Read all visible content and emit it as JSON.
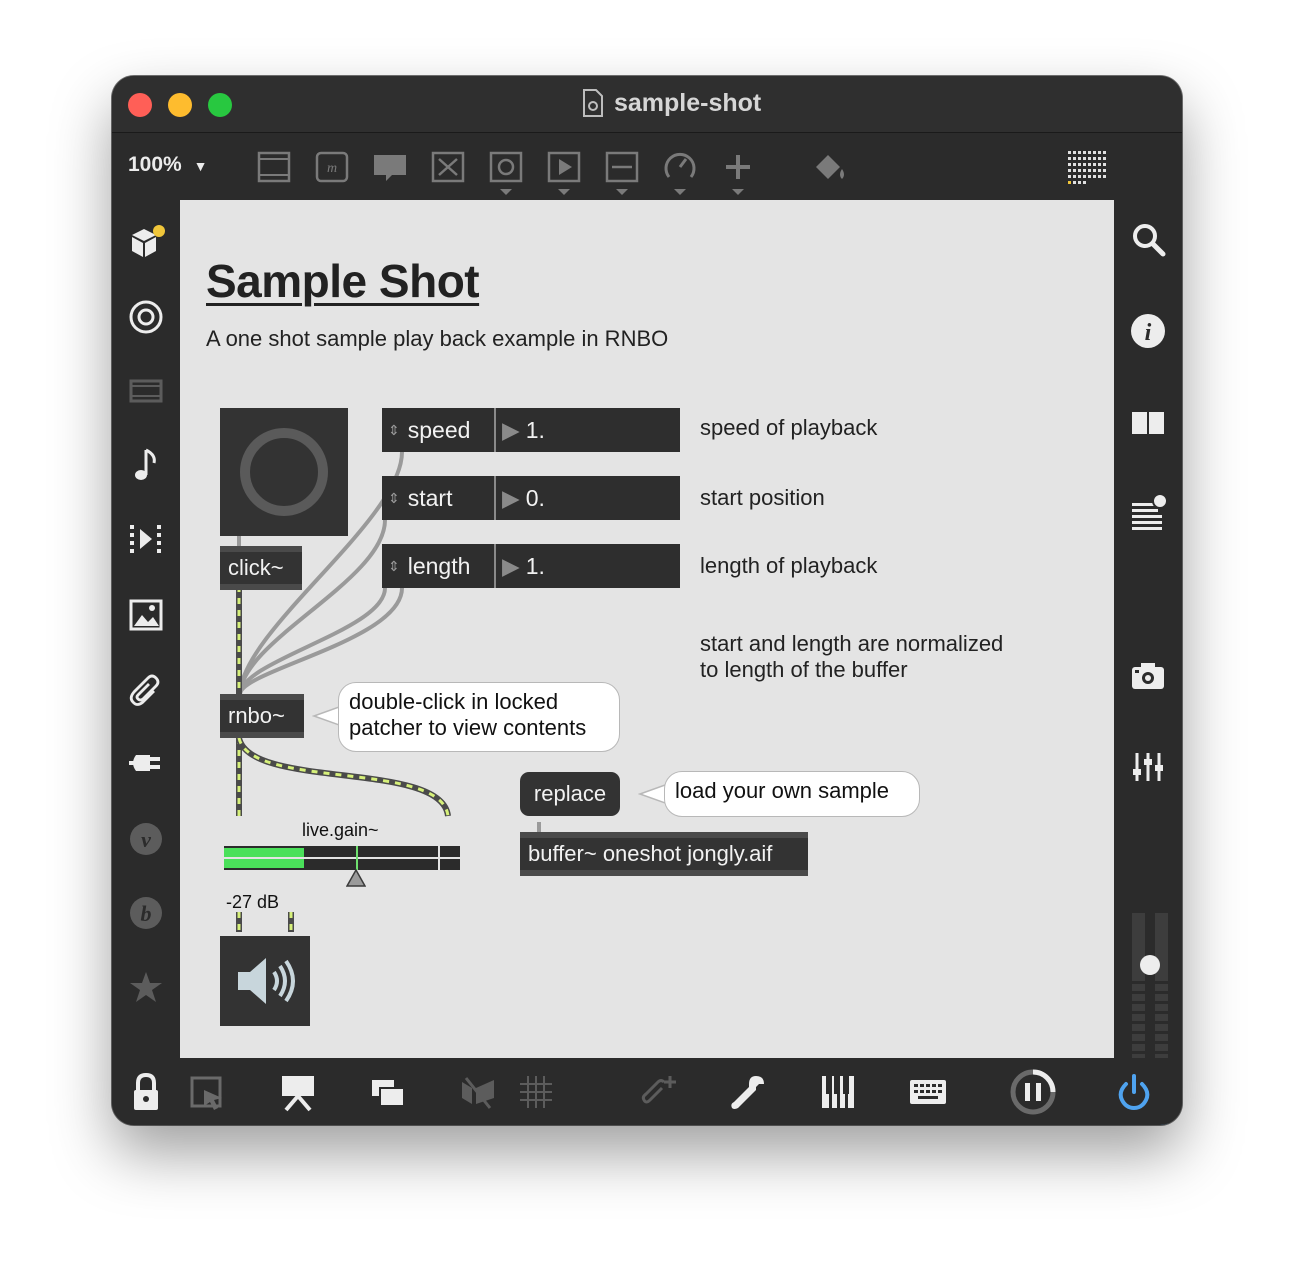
{
  "window": {
    "title": "sample-shot",
    "zoom": "100%",
    "colors": {
      "close": "#ff5f57",
      "minimize": "#febc2e",
      "maximize": "#28c840",
      "canvas": "#e4e4e4",
      "object": "#333333",
      "accent_blue": "#4fa3ef"
    }
  },
  "toolbar": {
    "icons": [
      "new-object-icon",
      "message-icon",
      "comment-icon",
      "button-icon",
      "toggle-icon",
      "play-icon",
      "slider-icon",
      "dial-icon",
      "add-icon",
      "paint-bucket-icon",
      "grid-icon"
    ]
  },
  "left_sidebar": {
    "icons": [
      "packages-icon",
      "target-icon",
      "film-icon",
      "music-note-icon",
      "step-icon",
      "image-icon",
      "paperclip-icon",
      "plug-icon",
      "v-icon",
      "b-icon",
      "star-icon"
    ]
  },
  "right_sidebar": {
    "icons": [
      "search-icon",
      "info-icon",
      "book-icon",
      "list-icon",
      "camera-icon",
      "mixer-icon"
    ],
    "meter_level": 0.6
  },
  "bottom_toolbar": {
    "icons": [
      "lock-icon",
      "select-icon",
      "presentation-icon",
      "windows-icon",
      "no-icon",
      "grid-icon",
      "attach-icon",
      "wrench-icon",
      "piano-icon",
      "keyboard-icon",
      "pause-icon",
      "power-icon"
    ]
  },
  "patcher": {
    "title": "Sample Shot",
    "subtitle": "A one shot sample play back example in RNBO",
    "params": [
      {
        "label": "speed",
        "value": "1.",
        "comment": "speed of playback"
      },
      {
        "label": "start",
        "value": "0.",
        "comment": "start position"
      },
      {
        "label": "length",
        "value": "1.",
        "comment": "length of playback"
      }
    ],
    "note_line1": "start and length are normalized",
    "note_line2": "to length of the buffer",
    "click_obj": "click~",
    "rnbo_obj": "rnbo~",
    "rnbo_tip_line1": "double-click in locked",
    "rnbo_tip_line2": "patcher to view contents",
    "replace_msg": "replace",
    "replace_tip": "load your own sample",
    "buffer_obj": "buffer~ oneshot jongly.aif",
    "gain_label": "live.gain~",
    "gain_value": "-27 dB",
    "gain_level": 0.34
  }
}
